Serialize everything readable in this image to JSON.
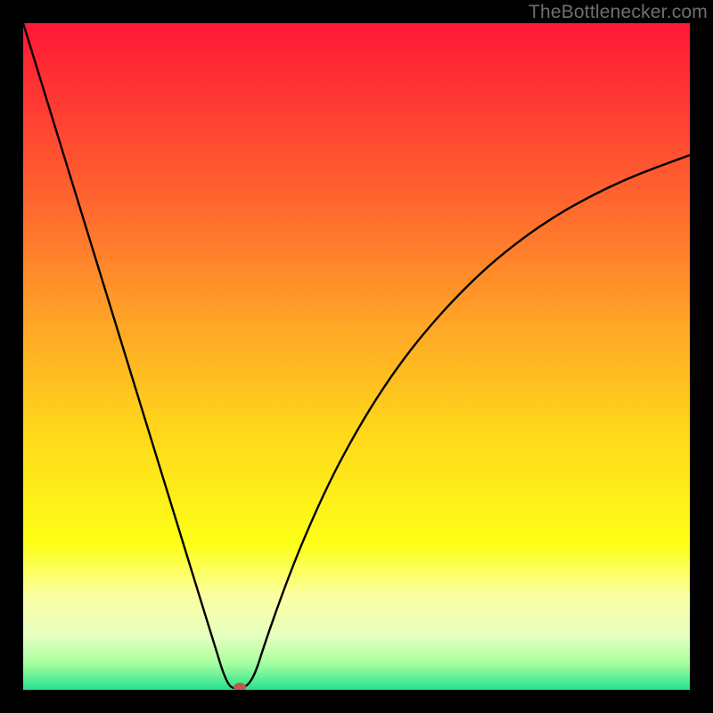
{
  "watermark": "TheBottlenecker.com",
  "chart_data": {
    "type": "line",
    "title": "",
    "xlabel": "",
    "ylabel": "",
    "xlim": [
      0,
      100
    ],
    "ylim": [
      0,
      100
    ],
    "background_gradient": {
      "stops": [
        {
          "offset": 0.0,
          "color": "#ff1836"
        },
        {
          "offset": 0.12,
          "color": "#ff3a33"
        },
        {
          "offset": 0.28,
          "color": "#ff6a2e"
        },
        {
          "offset": 0.45,
          "color": "#ffa526"
        },
        {
          "offset": 0.62,
          "color": "#ffd91a"
        },
        {
          "offset": 0.78,
          "color": "#feff17"
        },
        {
          "offset": 0.86,
          "color": "#faffa3"
        },
        {
          "offset": 0.92,
          "color": "#e6ffc0"
        },
        {
          "offset": 0.96,
          "color": "#a7ff9f"
        },
        {
          "offset": 1.0,
          "color": "#25e28e"
        }
      ]
    },
    "series": [
      {
        "name": "bottleneck-curve",
        "color": "#000000",
        "x": [
          0,
          2,
          4,
          6,
          8,
          10,
          12,
          14,
          16,
          18,
          20,
          22,
          24,
          26,
          28,
          29,
          30,
          31,
          32,
          33,
          34,
          35,
          36,
          38,
          40,
          42,
          45,
          48,
          52,
          56,
          60,
          65,
          70,
          75,
          80,
          85,
          90,
          95,
          100
        ],
        "y": [
          100,
          93.5,
          87,
          80.5,
          74,
          67.5,
          61,
          54.5,
          48,
          41.5,
          35,
          28.5,
          22,
          15.5,
          9,
          5.8,
          2.5,
          0.4,
          0.2,
          0.3,
          1.0,
          3.0,
          6.2,
          12.0,
          17.4,
          22.4,
          29.2,
          35.2,
          42.2,
          48.2,
          53.4,
          59.0,
          63.8,
          67.8,
          71.2,
          74.0,
          76.4,
          78.4,
          80.2
        ]
      }
    ],
    "marker": {
      "name": "optimal-point",
      "x": 32.5,
      "y": 0.0,
      "color": "#c05a4d",
      "rx": 7,
      "ry": 5
    }
  }
}
